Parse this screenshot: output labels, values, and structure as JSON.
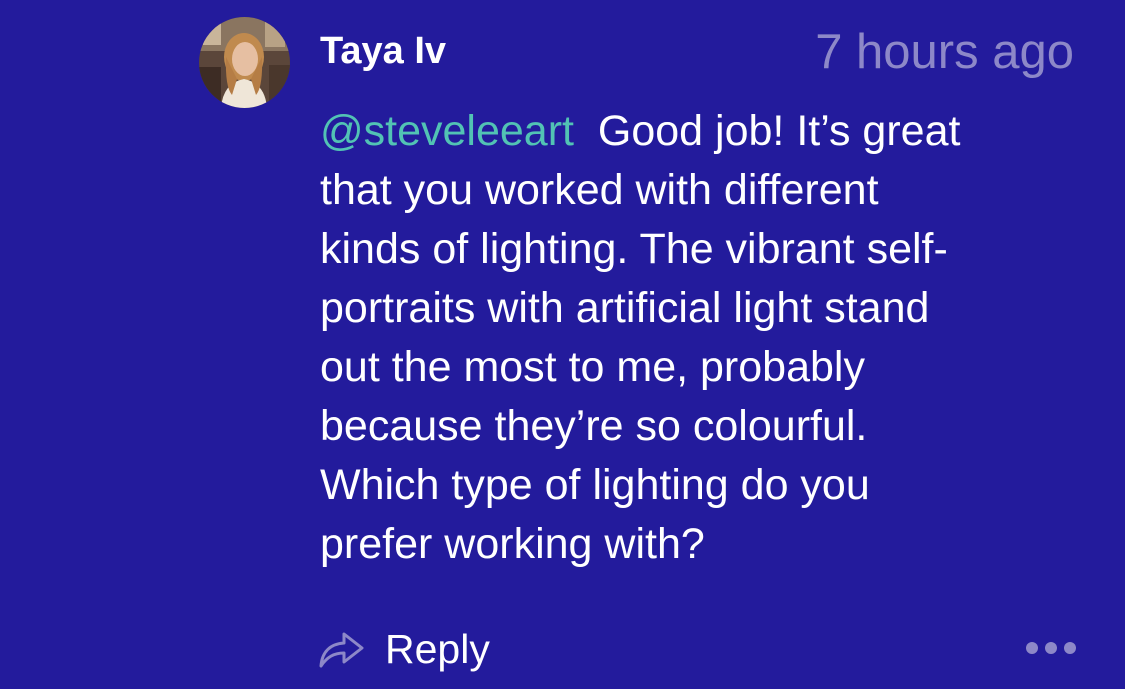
{
  "comment": {
    "author": "Taya Iv",
    "timestamp": "7 hours ago",
    "mention": "@steveleeart",
    "lines": [
      "Good job! It’s great",
      "that you worked with different",
      "kinds of lighting. The vibrant self-",
      "portraits with artificial light stand",
      "out the most to me, probably",
      "because they’re so colourful.",
      "Which type of lighting do you",
      "prefer working with?"
    ],
    "reply_label": "Reply"
  },
  "icons": {
    "avatar": "user-avatar-photo",
    "reply": "reply-arrow-icon",
    "more": "more-dots-icon"
  },
  "colors": {
    "background": "#231b9c",
    "text": "#ffffff",
    "mention": "#52c3b4",
    "muted": "#8d88c8"
  }
}
